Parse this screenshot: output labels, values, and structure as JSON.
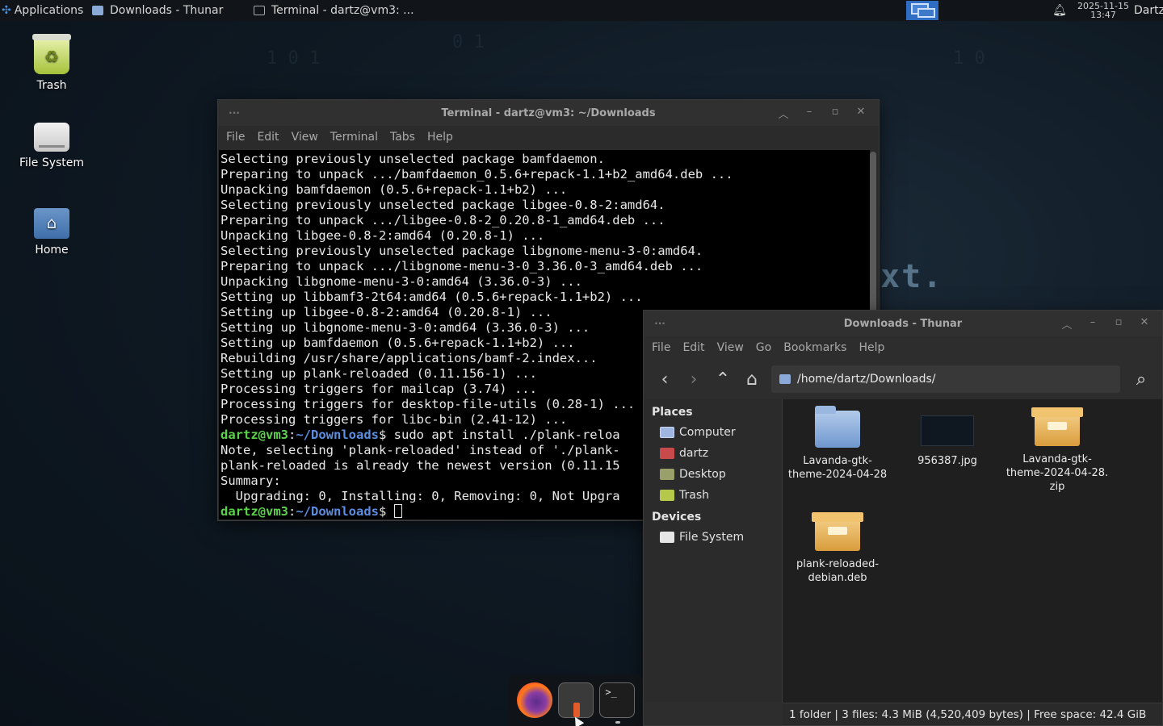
{
  "top_panel": {
    "apps_label": "Applications",
    "tasks": [
      {
        "label": "Downloads - Thunar",
        "icon": "folder-icon"
      },
      {
        "label": "Terminal - dartz@vm3: ...",
        "icon": "terminal-icon"
      }
    ],
    "clock_date": "2025-11-15",
    "clock_time": "13:47",
    "user": "Dartz",
    "accent": "#2f6dc2"
  },
  "desktop": {
    "icons": [
      {
        "label": "Trash",
        "icon": "trash-icon"
      },
      {
        "label": "File System",
        "icon": "drive-icon"
      },
      {
        "label": "Home",
        "icon": "home-folder-icon"
      }
    ],
    "wallpaper_text": "xt."
  },
  "terminal": {
    "title": "Terminal - dartz@vm3: ~/Downloads",
    "menu": [
      "File",
      "Edit",
      "View",
      "Terminal",
      "Tabs",
      "Help"
    ],
    "lines": [
      "Selecting previously unselected package bamfdaemon.",
      "Preparing to unpack .../bamfdaemon_0.5.6+repack-1.1+b2_amd64.deb ...",
      "Unpacking bamfdaemon (0.5.6+repack-1.1+b2) ...",
      "Selecting previously unselected package libgee-0.8-2:amd64.",
      "Preparing to unpack .../libgee-0.8-2_0.20.8-1_amd64.deb ...",
      "Unpacking libgee-0.8-2:amd64 (0.20.8-1) ...",
      "Selecting previously unselected package libgnome-menu-3-0:amd64.",
      "Preparing to unpack .../libgnome-menu-3-0_3.36.0-3_amd64.deb ...",
      "Unpacking libgnome-menu-3-0:amd64 (3.36.0-3) ...",
      "Setting up libbamf3-2t64:amd64 (0.5.6+repack-1.1+b2) ...",
      "Setting up libgee-0.8-2:amd64 (0.20.8-1) ...",
      "Setting up libgnome-menu-3-0:amd64 (3.36.0-3) ...",
      "Setting up bamfdaemon (0.5.6+repack-1.1+b2) ...",
      "Rebuilding /usr/share/applications/bamf-2.index...",
      "Setting up plank-reloaded (0.11.156-1) ...",
      "Processing triggers for mailcap (3.74) ...",
      "Processing triggers for desktop-file-utils (0.28-1) ...",
      "Processing triggers for libc-bin (2.41-12) ..."
    ],
    "prompt_user": "dartz@vm3",
    "prompt_sep": ":",
    "prompt_path": "~/Downloads",
    "prompt_sym": "$ ",
    "command": "sudo apt install ./plank-reloa",
    "after_lines": [
      "Note, selecting 'plank-reloaded' instead of './plank-",
      "plank-reloaded is already the newest version (0.11.15",
      "Summary:",
      "  Upgrading: 0, Installing: 0, Removing: 0, Not Upgra"
    ]
  },
  "thunar": {
    "title": "Downloads - Thunar",
    "menu": [
      "File",
      "Edit",
      "View",
      "Go",
      "Bookmarks",
      "Help"
    ],
    "location": "/home/dartz/Downloads/",
    "places_heading": "Places",
    "places": [
      {
        "label": "Computer",
        "icon": "computer-icon"
      },
      {
        "label": "dartz",
        "icon": "user-home-icon"
      },
      {
        "label": "Desktop",
        "icon": "desktop-icon"
      },
      {
        "label": "Trash",
        "icon": "trash-icon"
      }
    ],
    "devices_heading": "Devices",
    "devices": [
      {
        "label": "File System",
        "icon": "drive-icon"
      }
    ],
    "files": [
      {
        "line1": "Lavanda-gtk-",
        "line2": "theme-2024-04-28",
        "line3": "",
        "type": "folder"
      },
      {
        "line1": "956387.jpg",
        "line2": "",
        "line3": "",
        "type": "image"
      },
      {
        "line1": "Lavanda-gtk-",
        "line2": "theme-2024-04-28.",
        "line3": "zip",
        "type": "archive"
      },
      {
        "line1": "plank-reloaded-",
        "line2": "debian.deb",
        "line3": "",
        "type": "package"
      }
    ],
    "status": "1 folder  |  3 files: 4.3 MiB (4,520,409 bytes)  |  Free space: 42.4 GiB"
  },
  "dock": {
    "items": [
      {
        "name": "firefox",
        "icon": "firefox-icon"
      },
      {
        "name": "plank-installer",
        "icon": "installer-icon"
      },
      {
        "name": "terminal",
        "icon": "terminal-icon",
        "text": ">_"
      }
    ]
  }
}
